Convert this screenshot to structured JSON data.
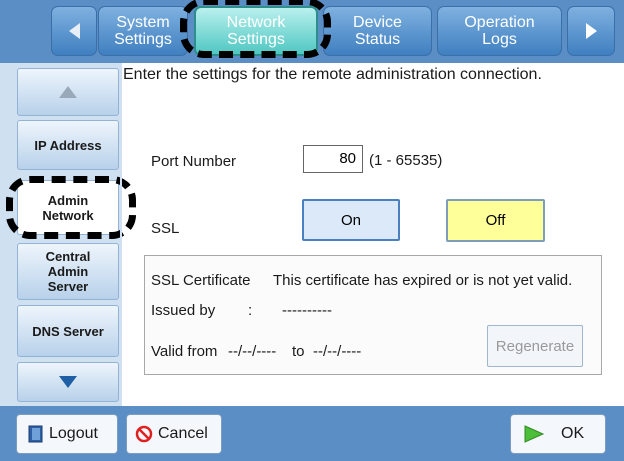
{
  "tabs": {
    "items": [
      {
        "label": "System\nSettings"
      },
      {
        "label": "Network\nSettings",
        "active": true
      },
      {
        "label": "Device\nStatus"
      },
      {
        "label": "Operation\nLogs"
      }
    ]
  },
  "sidebar": {
    "items": [
      {
        "label": "IP Address"
      },
      {
        "label": "Admin\nNetwork",
        "active": true
      },
      {
        "label": "Central\nAdmin\nServer"
      },
      {
        "label": "DNS Server"
      }
    ]
  },
  "main": {
    "instruction": "Enter the settings for the remote administration connection.",
    "port_label": "Port Number",
    "port_value": "80",
    "port_range": "(1 - 65535)",
    "ssl_label": "SSL",
    "ssl_on": "On",
    "ssl_off": "Off",
    "cert": {
      "title": "SSL Certificate",
      "status": "This certificate has expired or is not yet valid.",
      "issued_label": "Issued by",
      "issued_sep": ":",
      "issued_value": "----------",
      "valid_label": "Valid from",
      "valid_from": "--/--/----",
      "valid_to_label": "to",
      "valid_to": "--/--/----",
      "regenerate": "Regenerate"
    }
  },
  "bottom": {
    "logout": "Logout",
    "cancel": "Cancel",
    "ok": "OK"
  },
  "colors": {
    "bar": "#5b8ec4",
    "active_tab": "#4fc7c2",
    "off_button": "#ffff99",
    "on_button": "#dbe9f8"
  }
}
